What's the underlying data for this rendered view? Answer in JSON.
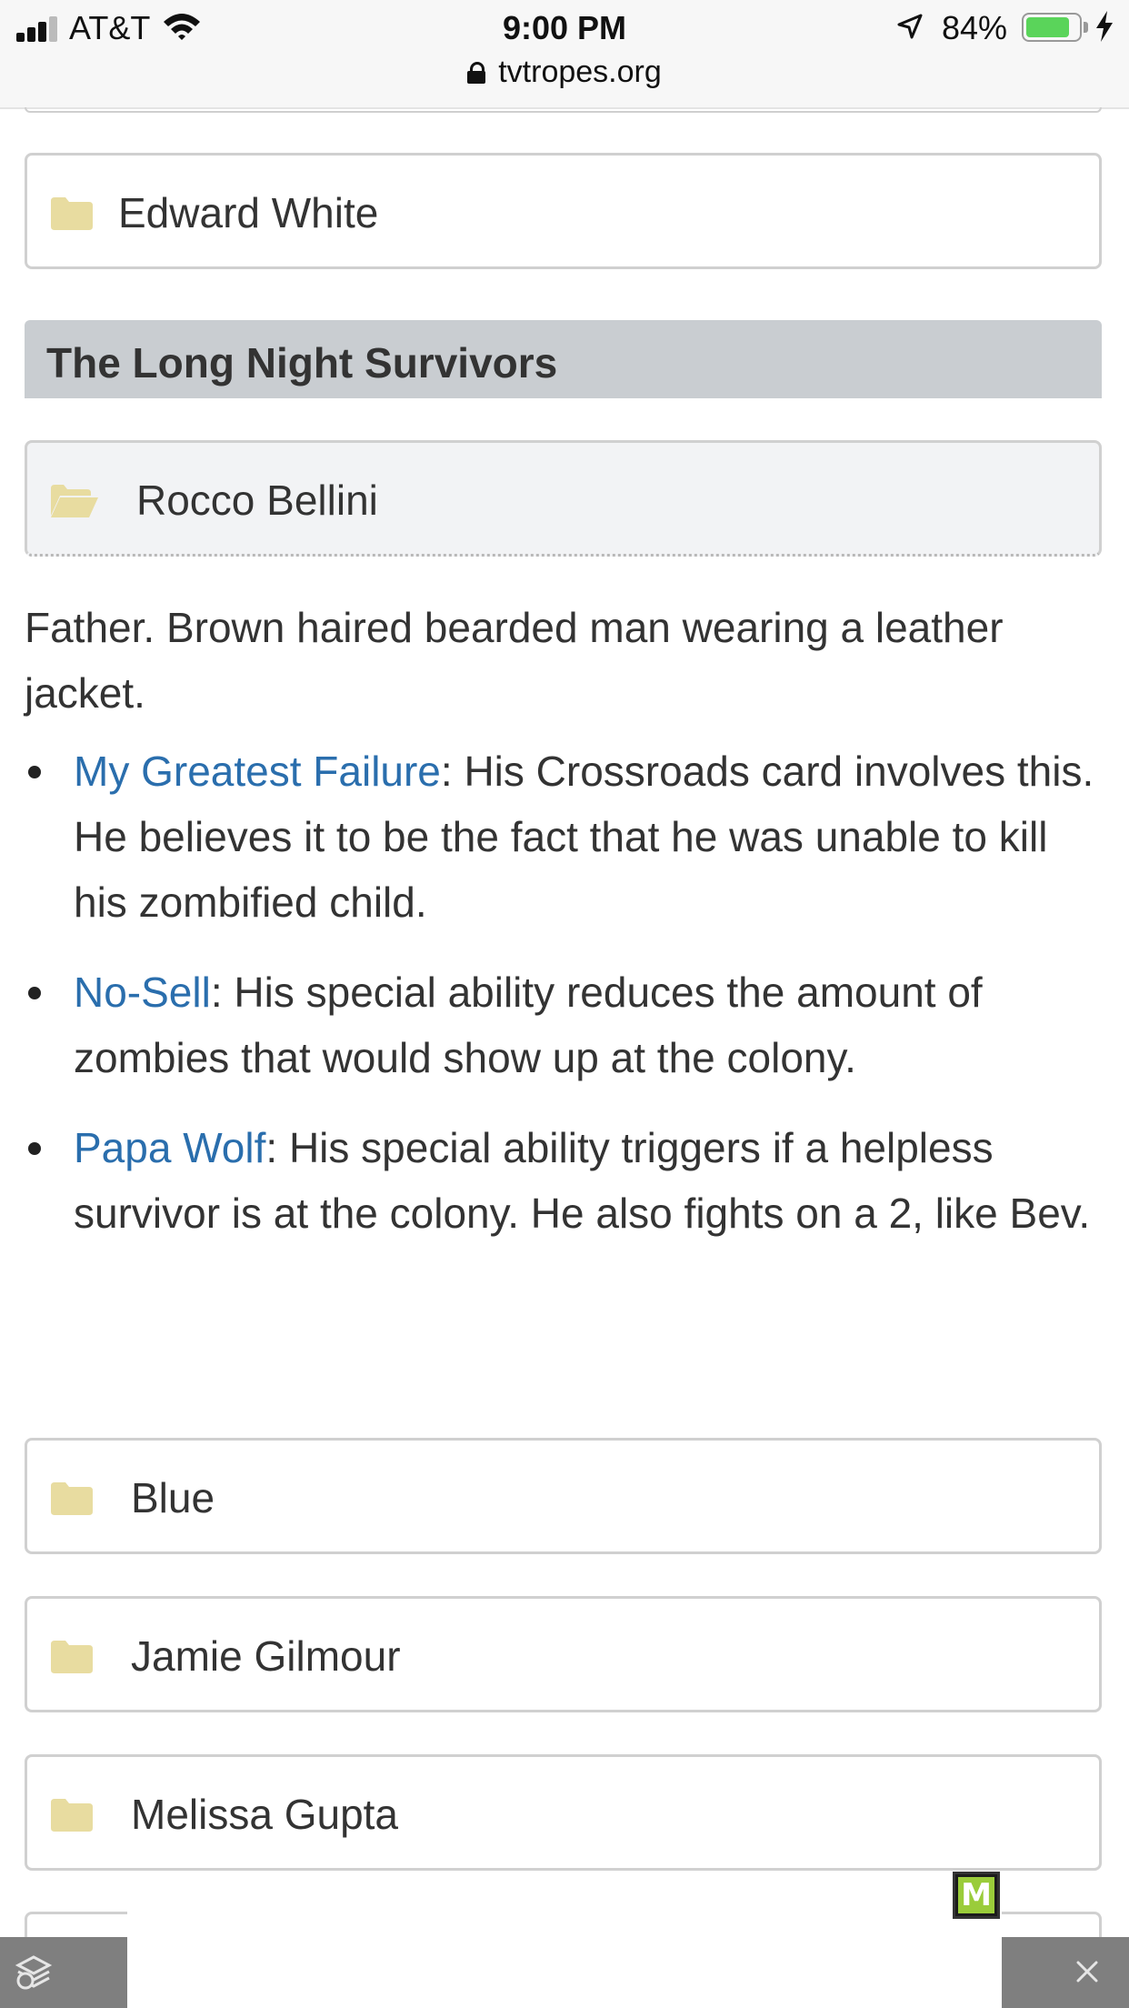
{
  "status_bar": {
    "carrier": "AT&T",
    "time": "9:00 PM",
    "battery_percent": "84%",
    "battery_level": 0.84,
    "url": "tvtropes.org"
  },
  "folders_top": [
    {
      "label": "Edward White"
    }
  ],
  "section": {
    "title": "The Long Night Survivors"
  },
  "open_folder": {
    "label": "Rocco Bellini"
  },
  "description": "Father. Brown haired bearded man wearing a leather jacket.",
  "tropes": [
    {
      "link": "My Greatest Failure",
      "text": ": His Crossroads card involves this. He believes it to be the fact that he was unable to kill his zombified child."
    },
    {
      "link": "No-Sell",
      "text": ": His special ability reduces the amount of zombies that would show up at the colony."
    },
    {
      "link": "Papa Wolf",
      "text": ": His special ability triggers if a helpless survivor is at the colony. He also fights on a 2, like Bev."
    }
  ],
  "folders_bottom": [
    {
      "label": "Blue"
    },
    {
      "label": "Jamie Gilmour"
    },
    {
      "label": "Melissa Gupta"
    }
  ],
  "ad": {
    "badge_letter": "M"
  },
  "icons": {
    "folder_closed": "folder-icon",
    "folder_open": "folder-open-icon",
    "close": "close-icon",
    "colors": {
      "folder": "#e8dca0",
      "link": "#2a6ead",
      "section_bg": "#c9cdd1"
    }
  }
}
